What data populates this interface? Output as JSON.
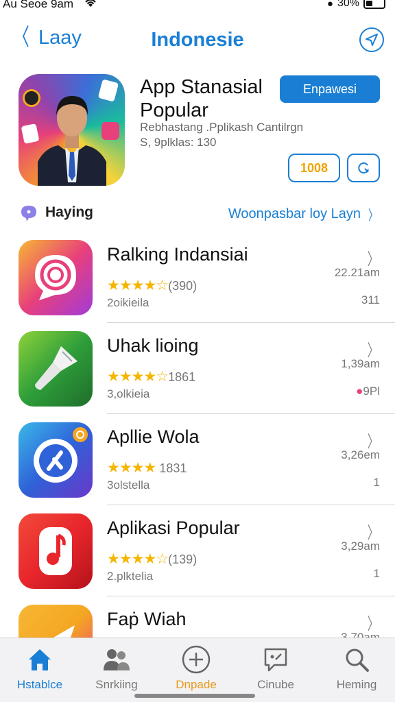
{
  "status_bar": {
    "left_text": "Au Seoe 9am",
    "battery_text": "30%"
  },
  "nav": {
    "back_label": "Laay",
    "title": "Indonesie"
  },
  "hero": {
    "title_line1": "App Stanasial",
    "title_line2": "Popular",
    "subtitle": "Rebhastang .Pplikash Cantilrgn",
    "meta": "S, 9plklas: 130",
    "button_label": "Enpawesi",
    "badge_label": "1008"
  },
  "section": {
    "title": "Haying",
    "link_label": "Woonpasbar loy Layn"
  },
  "apps": [
    {
      "name": "Ralking Indansiai",
      "stars": "★★★★☆",
      "rating": "(390)",
      "sub": "2oikieila",
      "time": "22.21am",
      "count": "311",
      "accent": "#e8407a"
    },
    {
      "name": "Uhak lioing",
      "stars": "★★★★☆",
      "rating": "1861",
      "sub": "3,olkieia",
      "time": "1,39am",
      "count": "9Pl",
      "accent": "#2e9e3a"
    },
    {
      "name": "Apllie Wola",
      "stars": "★★★★",
      "rating": "1831",
      "sub": "3olstella",
      "time": "3,26em",
      "count": "1",
      "accent": "#2f62d8"
    },
    {
      "name": "Aplikasi Popular",
      "stars": "★★★★☆",
      "rating": "(139)",
      "sub": "2.plktelia",
      "time": "3,29am",
      "count": "1",
      "accent": "#e8262c"
    },
    {
      "name": "Faṗ Wiah",
      "stars": "",
      "rating": "",
      "sub": "",
      "time": "3,70am",
      "count": "",
      "accent": "#f5a623"
    }
  ],
  "tabs": [
    {
      "label": "Hstablce",
      "icon": "home-icon"
    },
    {
      "label": "Snrkiing",
      "icon": "people-icon"
    },
    {
      "label": "Dnpade",
      "icon": "plus-circle-icon"
    },
    {
      "label": "Cinube",
      "icon": "chat-icon"
    },
    {
      "label": "Heming",
      "icon": "search-icon"
    }
  ],
  "colors": {
    "accent": "#1a7fd4",
    "star": "#f5b500",
    "orange": "#e59a1b"
  }
}
